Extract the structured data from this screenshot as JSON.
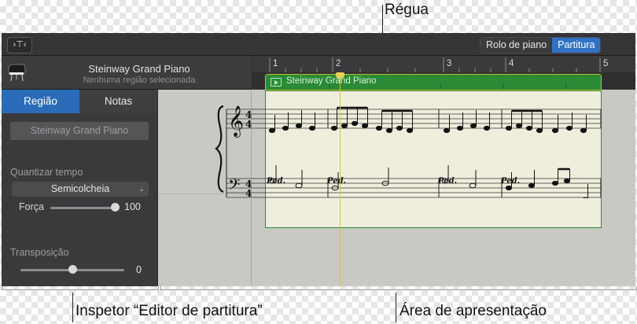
{
  "callouts": {
    "ruler": "Régua",
    "inspector": "Inspetor “Editor de partitura”",
    "display_area": "Área de apresentação"
  },
  "toolbar": {
    "filter_icon": "filter-icon",
    "view_modes": [
      "Rolo de piano",
      "Partitura"
    ],
    "selected_view": "Partitura",
    "accent_color": "#2f72c4"
  },
  "track_header": {
    "icon": "grand-piano-icon",
    "instrument_name": "Steinway Grand Piano",
    "subtitle": "Nenhuma região selecionada"
  },
  "inspector": {
    "tabs": [
      "Região",
      "Notas"
    ],
    "selected_tab": "Região",
    "region_name": "Steinway Grand Piano",
    "quantize": {
      "label": "Quantizar tempo",
      "selected_value": "Semicolcheia",
      "strength_label": "Força",
      "strength_value": "100",
      "strength_level": 1.0
    },
    "transpose": {
      "label": "Transposição",
      "value": "0",
      "level": 0.5
    }
  },
  "ruler": {
    "bars": [
      "1",
      "2",
      "3",
      "4",
      "5"
    ]
  },
  "region": {
    "name": "Steinway Grand Piano",
    "color": "#2a8a36",
    "pedal_marks": [
      "Ped.",
      "Ped.",
      "Ped.",
      "Ped."
    ],
    "time_signature": [
      "4",
      "4"
    ]
  }
}
